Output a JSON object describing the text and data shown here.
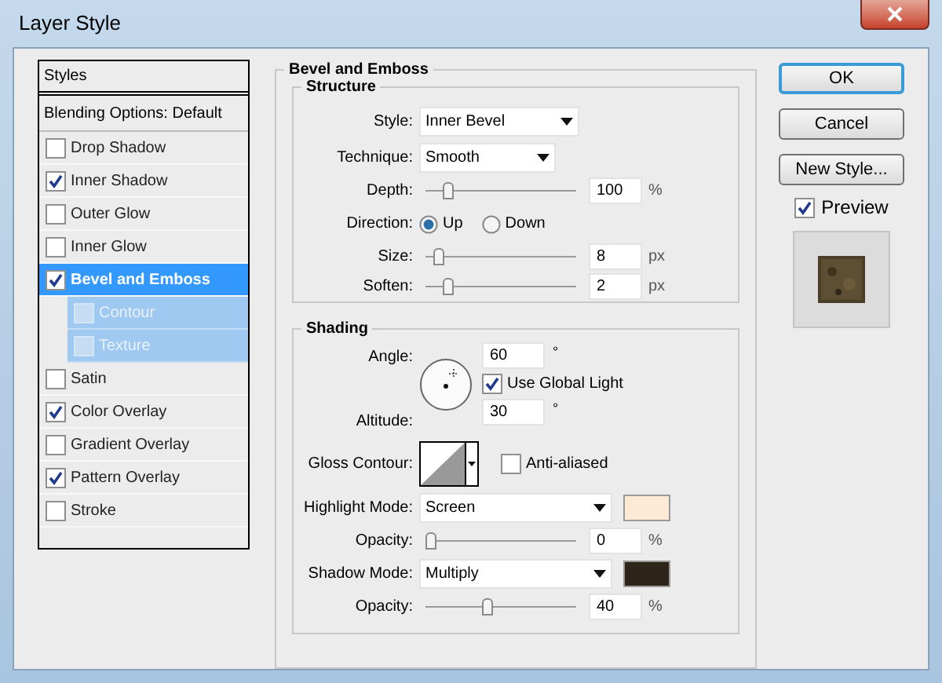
{
  "window": {
    "title": "Layer Style"
  },
  "sidebar": {
    "header": "Styles",
    "blending": "Blending Options: Default",
    "items": [
      {
        "label": "Drop Shadow",
        "checked": false,
        "selected": false
      },
      {
        "label": "Inner Shadow",
        "checked": true,
        "selected": false
      },
      {
        "label": "Outer Glow",
        "checked": false,
        "selected": false
      },
      {
        "label": "Inner Glow",
        "checked": false,
        "selected": false
      },
      {
        "label": "Bevel and Emboss",
        "checked": true,
        "selected": true,
        "children": [
          {
            "label": "Contour",
            "checked": false,
            "selected": false
          },
          {
            "label": "Texture",
            "checked": false,
            "selected": false
          }
        ]
      },
      {
        "label": "Satin",
        "checked": false,
        "selected": false
      },
      {
        "label": "Color Overlay",
        "checked": true,
        "selected": false
      },
      {
        "label": "Gradient Overlay",
        "checked": false,
        "selected": false
      },
      {
        "label": "Pattern Overlay",
        "checked": true,
        "selected": false
      },
      {
        "label": "Stroke",
        "checked": false,
        "selected": false
      }
    ]
  },
  "bevel": {
    "title": "Bevel and Emboss",
    "structure": {
      "title": "Structure",
      "rows": [
        {
          "kind": "dropdown",
          "label": "Style:",
          "value": "Inner Bevel"
        },
        {
          "kind": "dropdown",
          "label": "Technique:",
          "value": "Smooth"
        },
        {
          "kind": "slider",
          "label": "Depth:",
          "level": 0.12,
          "value": "100",
          "unit": "%"
        },
        {
          "kind": "radio",
          "label": "Direction:",
          "options": [
            {
              "label": "Up",
              "selected": true
            },
            {
              "label": "Down",
              "selected": false
            }
          ]
        },
        {
          "kind": "slider",
          "label": "Size:",
          "level": 0.06,
          "value": "8",
          "unit": "px"
        },
        {
          "kind": "slider",
          "label": "Soften:",
          "level": 0.12,
          "value": "2",
          "unit": "px"
        }
      ]
    },
    "shading": {
      "title": "Shading",
      "angle": {
        "label": "Angle:",
        "value": "60",
        "unit": "°"
      },
      "global_light": {
        "label": "Use Global Light",
        "checked": true
      },
      "altitude": {
        "label": "Altitude:",
        "value": "30",
        "unit": "°"
      },
      "gloss_contour": {
        "label": "Gloss Contour:"
      },
      "anti_aliased": {
        "label": "Anti-aliased",
        "checked": false
      },
      "rows": [
        {
          "kind": "dropdown",
          "label": "Highlight Mode:",
          "value": "Screen",
          "color": "#fde9d4"
        },
        {
          "kind": "slider",
          "label": "Opacity:",
          "level": 0,
          "value": "0",
          "unit": "%"
        },
        {
          "kind": "dropdown",
          "label": "Shadow Mode:",
          "value": "Multiply",
          "color": "#2e2419"
        },
        {
          "kind": "slider",
          "label": "Opacity:",
          "level": 0.4,
          "value": "40",
          "unit": "%"
        }
      ]
    }
  },
  "buttons": [
    {
      "label": "OK",
      "default": true
    },
    {
      "label": "Cancel",
      "default": false
    },
    {
      "label": "New Style...",
      "default": false
    }
  ],
  "preview": {
    "label": "Preview",
    "checked": true
  }
}
